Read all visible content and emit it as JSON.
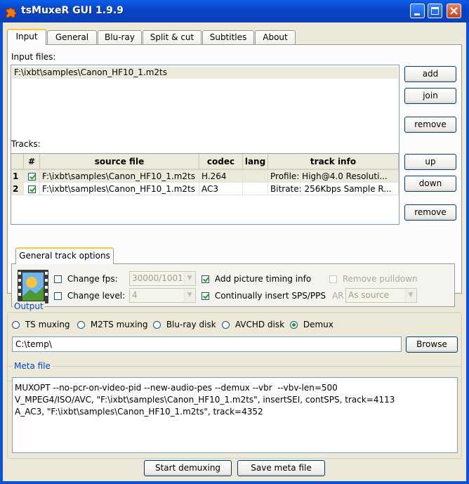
{
  "window": {
    "title": "tsMuxeR GUI 1.9.9"
  },
  "tabs": [
    {
      "label": "Input",
      "active": true
    },
    {
      "label": "General"
    },
    {
      "label": "Blu-ray"
    },
    {
      "label": "Split & cut"
    },
    {
      "label": "Subtitles"
    },
    {
      "label": "About"
    }
  ],
  "input": {
    "files_label": "Input files:",
    "files": [
      "F:\\ixbt\\samples\\Canon_HF10_1.m2ts"
    ],
    "add": "add",
    "join": "join",
    "remove": "remove"
  },
  "tracks": {
    "label": "Tracks:",
    "headers": {
      "num": "#",
      "source": "source file",
      "codec": "codec",
      "lang": "lang",
      "info": "track info"
    },
    "rows": [
      {
        "n": "1",
        "checked": true,
        "source": "F:\\ixbt\\samples\\Canon_HF10_1.m2ts",
        "codec": "H.264",
        "lang": "",
        "info": "Profile: High@4.0  Resoluti..."
      },
      {
        "n": "2",
        "checked": true,
        "source": "F:\\ixbt\\samples\\Canon_HF10_1.m2ts",
        "codec": "AC3",
        "lang": "",
        "info": "Bitrate: 256Kbps Sample R..."
      }
    ],
    "up": "up",
    "down": "down",
    "remove": "remove"
  },
  "track_options": {
    "tab": "General track options",
    "change_fps": "Change fps:",
    "fps_value": "30000/1001",
    "change_level": "Change level:",
    "level_value": "4",
    "add_timing": "Add picture timing info",
    "insert_sps": "Continually insert SPS/PPS",
    "remove_pulldown": "Remove pulldown",
    "ar_label": "AR",
    "ar_value": "As source"
  },
  "output": {
    "title": "Output",
    "modes": [
      {
        "label": "TS muxing",
        "selected": false
      },
      {
        "label": "M2TS muxing",
        "selected": false
      },
      {
        "label": "Blu-ray disk",
        "selected": false
      },
      {
        "label": "AVCHD disk",
        "selected": false
      },
      {
        "label": "Demux",
        "selected": true
      }
    ],
    "path": "C:\\temp\\",
    "browse": "Browse"
  },
  "meta": {
    "title": "Meta file",
    "text": "MUXOPT --no-pcr-on-video-pid --new-audio-pes --demux --vbr  --vbv-len=500\nV_MPEG4/ISO/AVC, \"F:\\ixbt\\samples\\Canon_HF10_1.m2ts\", insertSEI, contSPS, track=4113\nA_AC3, \"F:\\ixbt\\samples\\Canon_HF10_1.m2ts\", track=4352"
  },
  "footer": {
    "start": "Start demuxing",
    "save": "Save meta file"
  }
}
